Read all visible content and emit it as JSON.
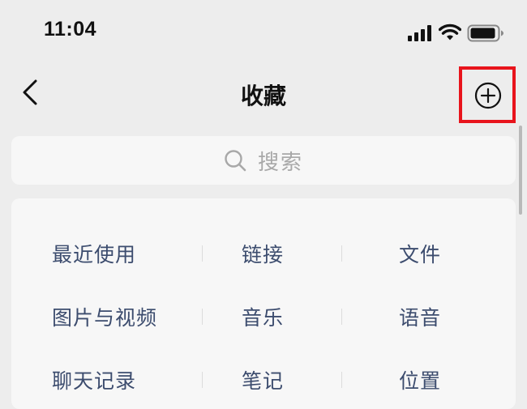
{
  "status_bar": {
    "time": "11:04",
    "icons": [
      "signal-icon",
      "wifi-icon",
      "battery-icon"
    ]
  },
  "nav": {
    "title": "收藏",
    "back_icon": "chevron-left-icon",
    "add_icon": "plus-circle-icon",
    "highlight_color": "#e8141c"
  },
  "search": {
    "placeholder": "搜索",
    "icon": "search-icon"
  },
  "categories": {
    "rows": [
      [
        "最近使用",
        "链接",
        "文件"
      ],
      [
        "图片与视频",
        "音乐",
        "语音"
      ],
      [
        "聊天记录",
        "笔记",
        "位置"
      ]
    ]
  },
  "colors": {
    "background": "#ededed",
    "card": "#f7f7f7",
    "category_text": "#3c4c6e"
  }
}
